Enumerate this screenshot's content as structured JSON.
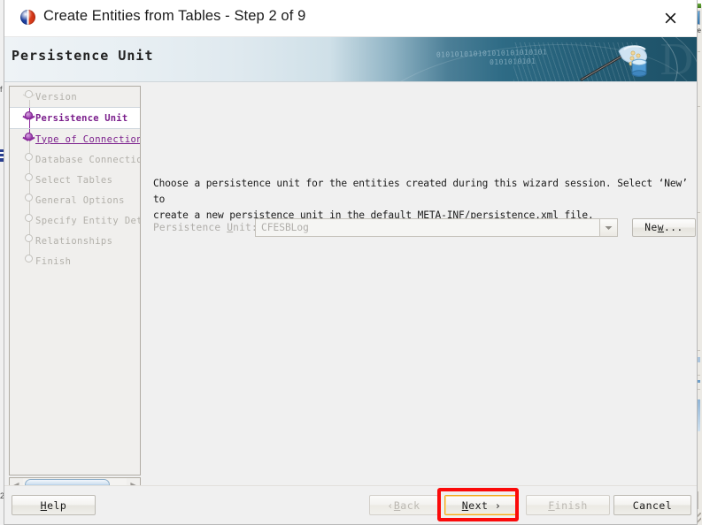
{
  "window": {
    "title": "Create Entities from Tables - Step 2 of 9",
    "app_icon": "netbeans-logo-icon",
    "close_label": "✕"
  },
  "banner": {
    "heading": "Persistence Unit",
    "binary_line1": "010101010101010101010101",
    "binary_line2": "0101010101"
  },
  "sidebar": {
    "steps": [
      {
        "label": "Version",
        "state": "done"
      },
      {
        "label": "Persistence Unit",
        "state": "current"
      },
      {
        "label": "Type of Connection",
        "state": "link"
      },
      {
        "label": "Database Connection",
        "state": "pending"
      },
      {
        "label": "Select Tables",
        "state": "pending"
      },
      {
        "label": "General Options",
        "state": "pending"
      },
      {
        "label": "Specify Entity Deta",
        "state": "pending"
      },
      {
        "label": "Relationships",
        "state": "pending"
      },
      {
        "label": "Finish",
        "state": "pending"
      }
    ],
    "scroll_left_icon": "◀",
    "scroll_right_icon": "▶"
  },
  "main": {
    "description_line1": "Choose a persistence unit for the entities created during this wizard session.  Select ‘New’ to",
    "description_line2": "create a new persistence unit in the default META-INF/persistence.xml file.",
    "persistence_unit_label_pre": "Persistence ",
    "persistence_unit_label_mnemonic": "U",
    "persistence_unit_label_post": "nit:",
    "persistence_unit_value": "CFESBLog",
    "new_button_pre": "Ne",
    "new_button_mnemonic": "w",
    "new_button_post": "..."
  },
  "footer": {
    "help_mnemonic": "H",
    "help_post": "elp",
    "back_pre": "‹ ",
    "back_mnemonic": "B",
    "back_post": "ack",
    "next_mnemonic": "N",
    "next_post": "ext ›",
    "finish_mnemonic": "F",
    "finish_post": "inish",
    "cancel_label": "Cancel"
  },
  "annotation": {
    "highlight_target": "next-button",
    "highlight_color": "#fb0a0a"
  },
  "background": {
    "left_text_fragment": "f",
    "left_text_fragment2": "2",
    "right_text_fragment": "Se"
  }
}
